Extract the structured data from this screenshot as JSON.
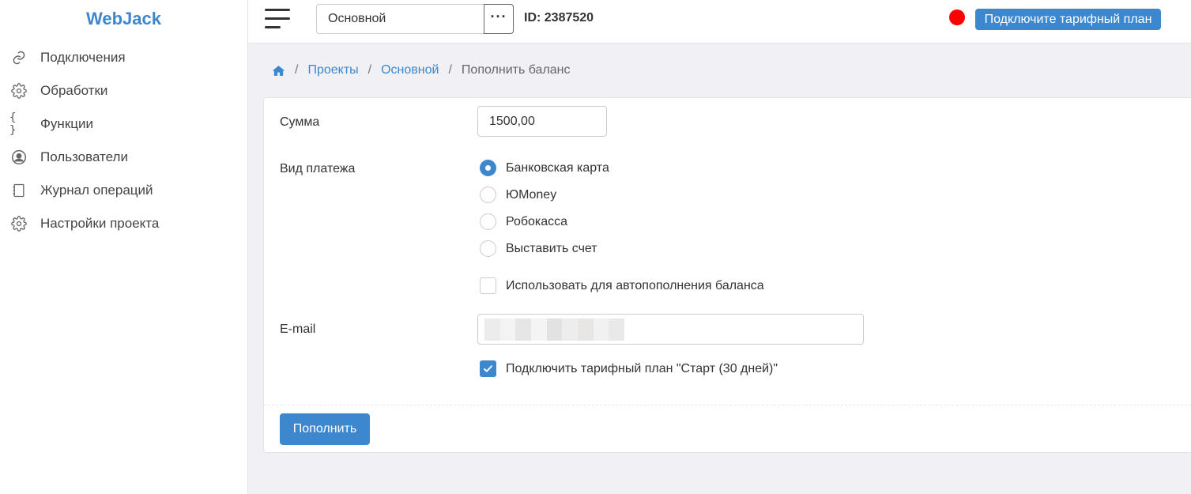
{
  "app": {
    "brand": "WebJack"
  },
  "sidebar": {
    "items": [
      {
        "label": "Подключения",
        "icon": "link-icon"
      },
      {
        "label": "Обработки",
        "icon": "gear-icon"
      },
      {
        "label": "Функции",
        "icon": "braces-icon"
      },
      {
        "label": "Пользователи",
        "icon": "user-circle-icon"
      },
      {
        "label": "Журнал операций",
        "icon": "notebook-icon"
      },
      {
        "label": "Настройки проекта",
        "icon": "gear-icon"
      }
    ]
  },
  "topbar": {
    "project_name": "Основной",
    "more_label": "···",
    "project_id": "ID: 2387520",
    "status_color": "#ff0000",
    "plan_button": "Подключите тарифный план"
  },
  "breadcrumb": {
    "items": [
      "Проекты",
      "Основной"
    ],
    "current": "Пополнить баланс",
    "separator": "/"
  },
  "form": {
    "amount_label": "Сумма",
    "amount_value": "1500,00",
    "payment_label": "Вид платежа",
    "payment_options": [
      {
        "label": "Банковская карта",
        "checked": true
      },
      {
        "label": "ЮMoney",
        "checked": false
      },
      {
        "label": "Робокасса",
        "checked": false
      },
      {
        "label": "Выставить счет",
        "checked": false
      }
    ],
    "autopay_label": "Использовать для автопополнения баланса",
    "autopay_checked": false,
    "email_label": "E-mail",
    "email_value": "",
    "plan_label": "Подключить тарифный план \"Старт (30 дней)\"",
    "plan_checked": true,
    "submit_label": "Пополнить"
  },
  "colors": {
    "accent": "#3d87cf"
  }
}
